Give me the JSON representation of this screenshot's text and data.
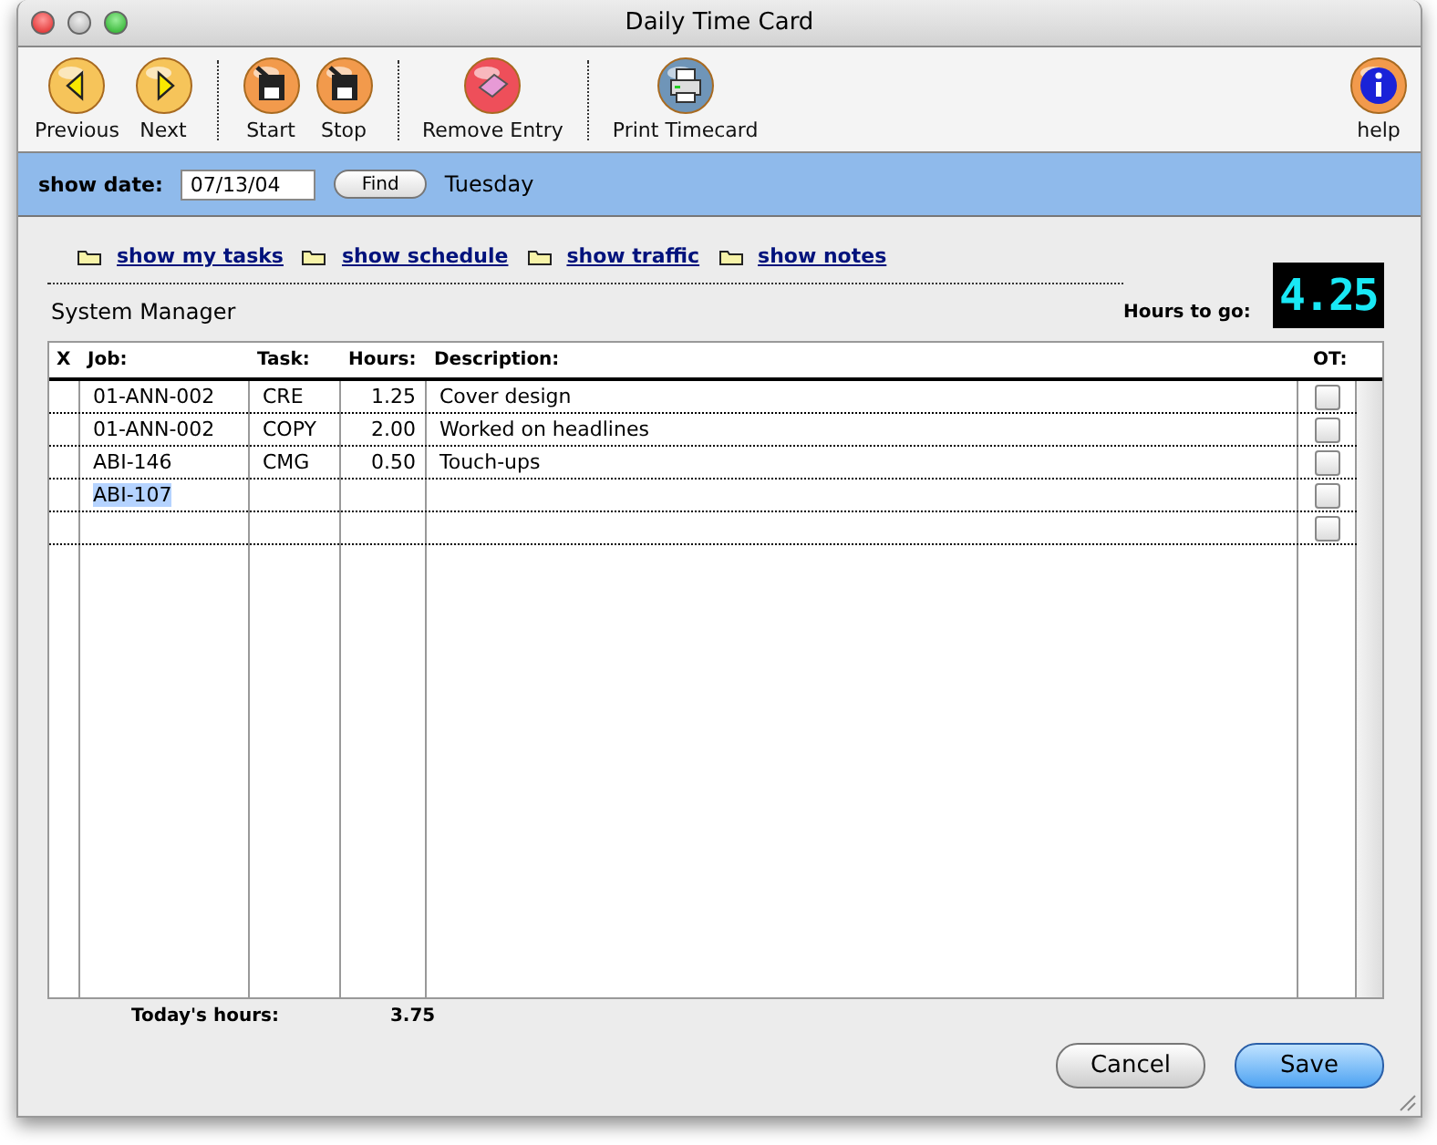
{
  "window": {
    "title": "Daily Time Card"
  },
  "toolbar": [
    {
      "kind": "previous",
      "label": "Previous"
    },
    {
      "kind": "next",
      "label": "Next"
    },
    {
      "kind": "separator"
    },
    {
      "kind": "start",
      "label": "Start"
    },
    {
      "kind": "stop",
      "label": "Stop"
    },
    {
      "kind": "separator"
    },
    {
      "kind": "remove",
      "label": "Remove Entry"
    },
    {
      "kind": "separator"
    },
    {
      "kind": "print",
      "label": "Print Timecard"
    },
    {
      "kind": "help",
      "label": "help"
    }
  ],
  "date_bar": {
    "label": "show date:",
    "date": "07/13/04",
    "button": "Find",
    "weekday": "Tuesday"
  },
  "links": [
    "show my tasks",
    "show schedule",
    "show traffic",
    "show notes"
  ],
  "user": "System Manager",
  "hours_to_go": {
    "label": "Hours to go:",
    "display": "4.25"
  },
  "table": {
    "columns": [
      "X",
      "Job:",
      "Task:",
      "Hours:",
      "Description:",
      "OT:"
    ],
    "rows": [
      {
        "job": "01-ANN-002",
        "task": "CRE",
        "hours": "1.25",
        "description": "Cover design",
        "ot": false,
        "job_selected": false
      },
      {
        "job": "01-ANN-002",
        "task": "COPY",
        "hours": "2.00",
        "description": "Worked on headlines",
        "ot": false,
        "job_selected": false
      },
      {
        "job": "ABI-146",
        "task": "CMG",
        "hours": "0.50",
        "description": "Touch-ups",
        "ot": false,
        "job_selected": false
      },
      {
        "job": "ABI-107",
        "ot": false,
        "job_selected": true
      },
      {
        "ot": false,
        "job_selected": false
      }
    ]
  },
  "totals": {
    "label": "Today's hours:",
    "value": "3.75"
  },
  "buttons": [
    {
      "label": "Cancel",
      "default": false
    },
    {
      "label": "Save",
      "default": true
    }
  ]
}
